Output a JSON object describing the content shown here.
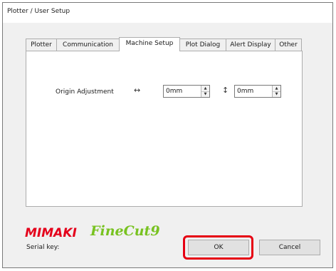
{
  "window": {
    "title": "Plotter / User Setup"
  },
  "tabs": [
    {
      "label": "Plotter"
    },
    {
      "label": "Communication"
    },
    {
      "label": "Machine Setup"
    },
    {
      "label": "Plot Dialog"
    },
    {
      "label": "Alert Display"
    },
    {
      "label": "Other"
    }
  ],
  "active_tab": "Machine Setup",
  "machine_setup": {
    "origin_label": "Origin Adjustment",
    "horizontal_value": "0mm",
    "vertical_value": "0mm",
    "horizontal_icon": "horizontal-double-arrow-icon",
    "vertical_icon": "vertical-double-arrow-icon"
  },
  "branding": {
    "mimaki": "MIMAKI",
    "finecut": "FineCut9",
    "mimaki_color": "#e4001b",
    "finecut_color": "#78c220"
  },
  "footer": {
    "serial_label": "Serial key:",
    "ok_label": "OK",
    "cancel_label": "Cancel",
    "highlight_color": "#e60012"
  }
}
